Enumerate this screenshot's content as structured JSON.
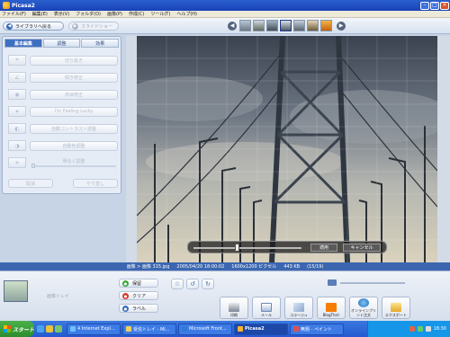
{
  "window": {
    "title": "Picasa2"
  },
  "menu": [
    "ファイル(F)",
    "編集(E)",
    "表示(V)",
    "フォルダ(O)",
    "画像(P)",
    "作成(C)",
    "ツール(T)",
    "ヘルプ(H)"
  ],
  "toolbar": {
    "back_label": "ライブラリへ戻る",
    "slideshow_label": "スライドショー"
  },
  "tabs": [
    "基本編集",
    "調整",
    "効果"
  ],
  "tools": [
    {
      "label": "切り抜き"
    },
    {
      "label": "傾き修正"
    },
    {
      "label": "赤目修正"
    },
    {
      "label": "I'm Feeling Lucky"
    },
    {
      "label": "自動コントラスト調整"
    },
    {
      "label": "自動色調整"
    },
    {
      "label": "明るく調整"
    }
  ],
  "panel_buttons": {
    "undo": "取消",
    "redo": "やり直し"
  },
  "edit_bar": {
    "apply": "適用",
    "cancel": "キャンセル"
  },
  "status": {
    "name": "画像 > 画像 315.jpg",
    "date": "2005/04/20 18:00:02",
    "dims": "1600x1200 ピクセル",
    "size": "443 KB",
    "index": "(15/19)"
  },
  "tray": {
    "label": "画像トレイ",
    "actions": [
      "保留",
      "クリア",
      "ラベル"
    ],
    "buttons": [
      "印刷",
      "メール",
      "コラージュ",
      "BlogThis!",
      "オンラインプリント注文",
      "エクスポート"
    ]
  },
  "taskbar": {
    "start": "スタート",
    "tasks": [
      "4 Internet Expl...",
      "受信トレイ - Mi...",
      "Microsoft Front...",
      "Picasa2",
      "無題 - ペイント"
    ],
    "active_index": 3,
    "clock": "18:30"
  },
  "colors": {
    "titlebar": "#1f4ec4",
    "status": "#3c67b0",
    "accent": "#3f6fc0"
  }
}
